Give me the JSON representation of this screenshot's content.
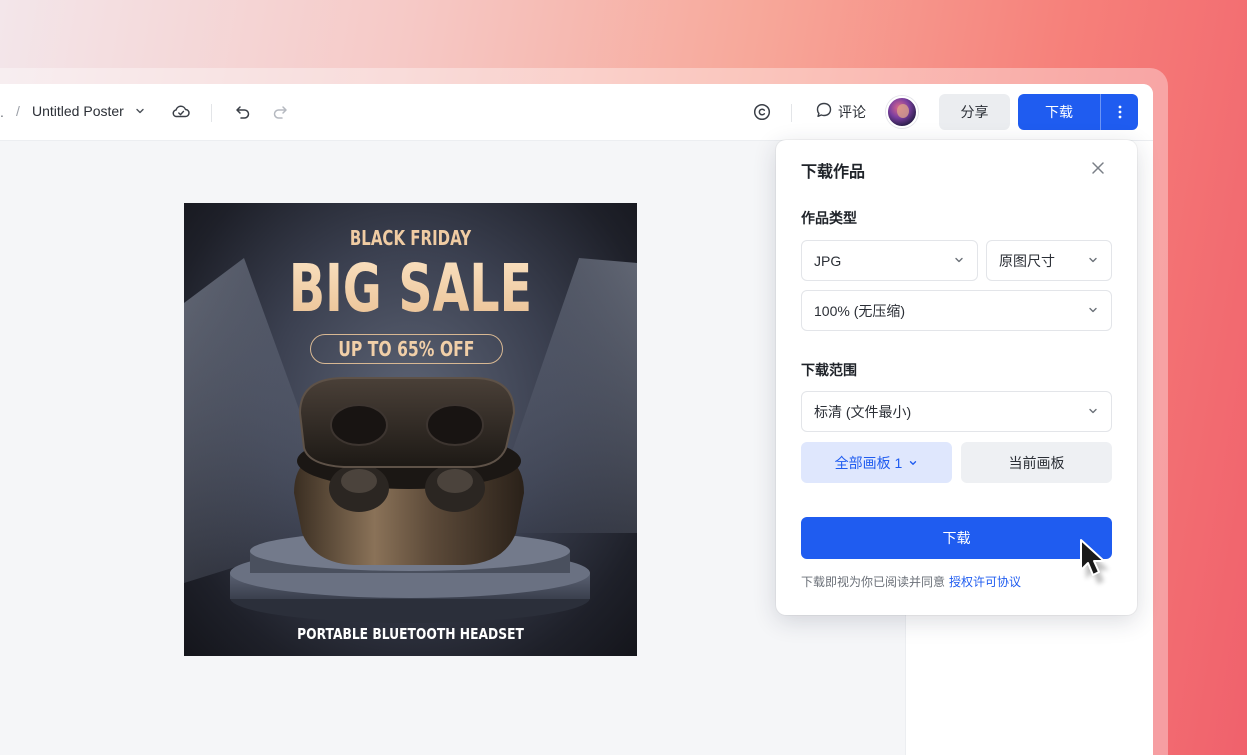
{
  "header": {
    "crumb_prefix": ".",
    "crumb_separator": "/",
    "doc_title": "Untitled Poster",
    "comment_label": "评论",
    "share_label": "分享",
    "download_label": "下载"
  },
  "poster": {
    "line1": "BLACK FRIDAY",
    "line2": "BIG SALE",
    "badge": "UP TO 65% OFF",
    "footer": "PORTABLE  BLUETOOTH  HEADSET"
  },
  "download_panel": {
    "title": "下载作品",
    "type_section": "作品类型",
    "format": {
      "value": "JPG"
    },
    "size": {
      "value": "原图尺寸"
    },
    "quality": {
      "value": "100% (无压缩)"
    },
    "range_section": "下载范围",
    "resolution": {
      "value": "标清 (文件最小)"
    },
    "scope_all": "全部画板 1",
    "scope_current": "当前画板",
    "download_button": "下载",
    "agreement_text": "下载即视为你已阅读并同意",
    "agreement_link": "授权许可协议"
  },
  "colors": {
    "accent": "#1f5cf0",
    "accent_light": "#dfe7fd",
    "poster_gold": "#f0cca3"
  },
  "icons": [
    "chevron-down-icon",
    "cloud-icon",
    "undo-icon",
    "redo-icon",
    "copyright-icon",
    "comment-icon",
    "more-vertical-icon",
    "close-icon",
    "cursor-icon"
  ]
}
